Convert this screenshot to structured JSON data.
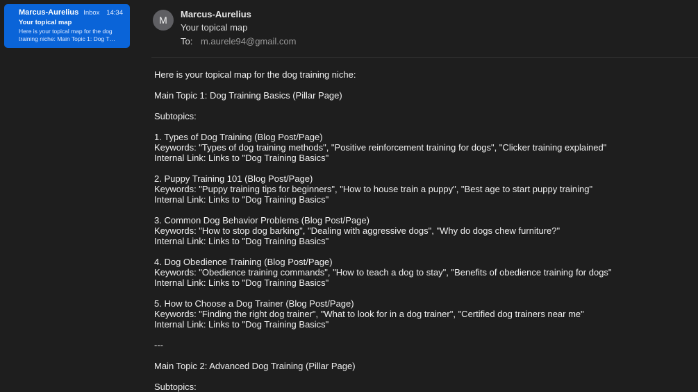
{
  "message_list": {
    "selected": {
      "sender": "Marcus-Aurelius",
      "mailbox": "Inbox",
      "time": "14:34",
      "subject": "Your topical map",
      "preview": "Here is your topical map for the dog training niche: Main Topic 1: Dog T…"
    }
  },
  "email": {
    "avatar_letter": "M",
    "from": "Marcus-Aurelius",
    "subject": "Your topical map",
    "to_label": "To:",
    "to_address": "m.aurele94@gmail.com",
    "intro": "Here is your topical map for the dog training niche:",
    "main_topic_1": "Main Topic 1: Dog Training Basics (Pillar Page)",
    "subtopics_label_1": "Subtopics:",
    "subtopics": [
      {
        "title": "1. Types of Dog Training (Blog Post/Page)",
        "keywords": "Keywords: \"Types of dog training methods\", \"Positive reinforcement training for dogs\", \"Clicker training explained\"",
        "link": "Internal Link: Links to \"Dog Training Basics\""
      },
      {
        "title": "2. Puppy Training 101 (Blog Post/Page)",
        "keywords": "Keywords: \"Puppy training tips for beginners\", \"How to house train a puppy\", \"Best age to start puppy training\"",
        "link": "Internal Link: Links to \"Dog Training Basics\""
      },
      {
        "title": "3. Common Dog Behavior Problems (Blog Post/Page)",
        "keywords": "Keywords: \"How to stop dog barking\", \"Dealing with aggressive dogs\", \"Why do dogs chew furniture?\"",
        "link": "Internal Link: Links to \"Dog Training Basics\""
      },
      {
        "title": "4. Dog Obedience Training (Blog Post/Page)",
        "keywords": "Keywords: \"Obedience training commands\", \"How to teach a dog to stay\", \"Benefits of obedience training for dogs\"",
        "link": "Internal Link: Links to \"Dog Training Basics\""
      },
      {
        "title": "5. How to Choose a Dog Trainer (Blog Post/Page)",
        "keywords": "Keywords: \"Finding the right dog trainer\", \"What to look for in a dog trainer\", \"Certified dog trainers near me\"",
        "link": "Internal Link: Links to \"Dog Training Basics\""
      }
    ],
    "separator": "---",
    "main_topic_2": "Main Topic 2: Advanced Dog Training (Pillar Page)",
    "subtopics_label_2": "Subtopics:"
  },
  "colors": {
    "background": "#1e1e1e",
    "selection": "#0a64d8",
    "text": "#f0f0f0",
    "muted": "#9a9a9a"
  }
}
